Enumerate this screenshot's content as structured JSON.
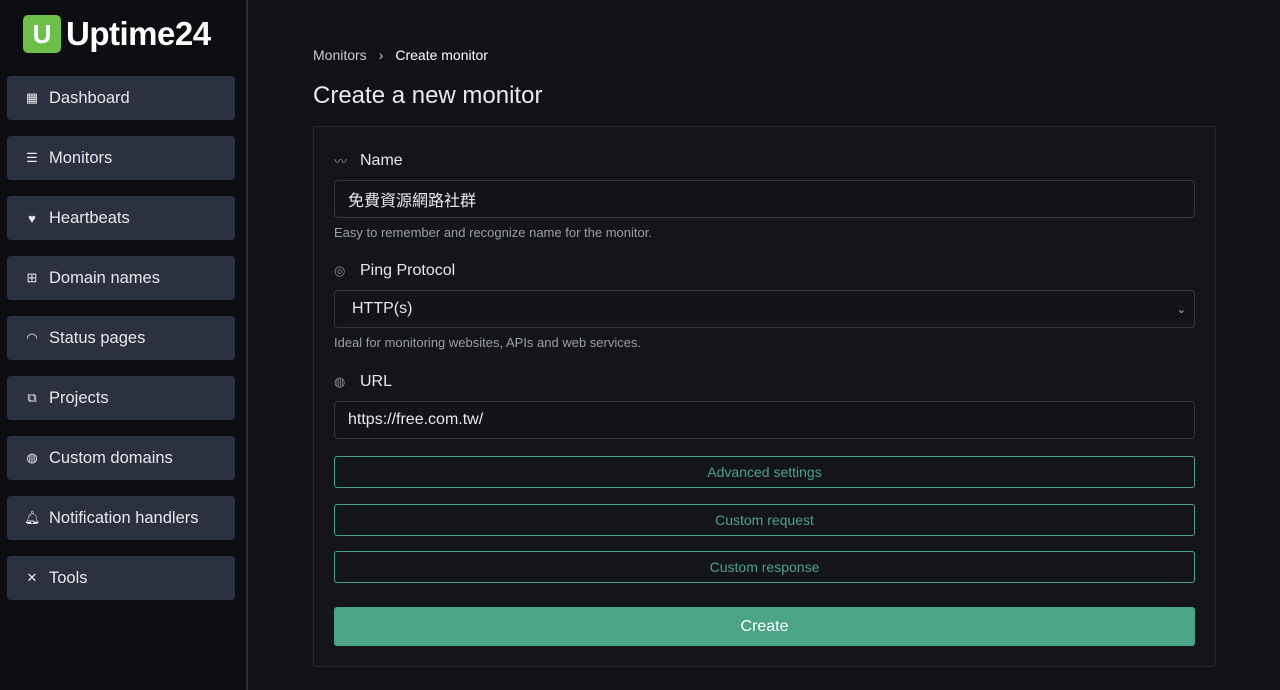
{
  "brand": {
    "logo_letter": "U",
    "name": "Uptime24",
    "color": "#6cc04a"
  },
  "sidebar": {
    "items": [
      {
        "label": "Dashboard",
        "icon": "grid-icon"
      },
      {
        "label": "Monitors",
        "icon": "server-icon"
      },
      {
        "label": "Heartbeats",
        "icon": "heart-pulse-icon"
      },
      {
        "label": "Domain names",
        "icon": "sitemap-icon"
      },
      {
        "label": "Status pages",
        "icon": "wifi-icon"
      },
      {
        "label": "Projects",
        "icon": "diagram-icon"
      },
      {
        "label": "Custom domains",
        "icon": "globe-icon"
      },
      {
        "label": "Notification handlers",
        "icon": "bell-icon"
      },
      {
        "label": "Tools",
        "icon": "tools-icon"
      }
    ]
  },
  "breadcrumb": {
    "parent": "Monitors",
    "separator": "›",
    "current": "Create monitor"
  },
  "page_title": "Create a new monitor",
  "form": {
    "name": {
      "label": "Name",
      "value": "免費資源網路社群",
      "help": "Easy to remember and recognize name for the monitor."
    },
    "protocol": {
      "label": "Ping Protocol",
      "value": "HTTP(s)",
      "help": "Ideal for monitoring websites, APIs and web services."
    },
    "url": {
      "label": "URL",
      "value": "https://free.com.tw/"
    },
    "advanced_label": "Advanced settings",
    "custom_request_label": "Custom request",
    "custom_response_label": "Custom response",
    "create_label": "Create"
  },
  "accent": "#4ba388"
}
